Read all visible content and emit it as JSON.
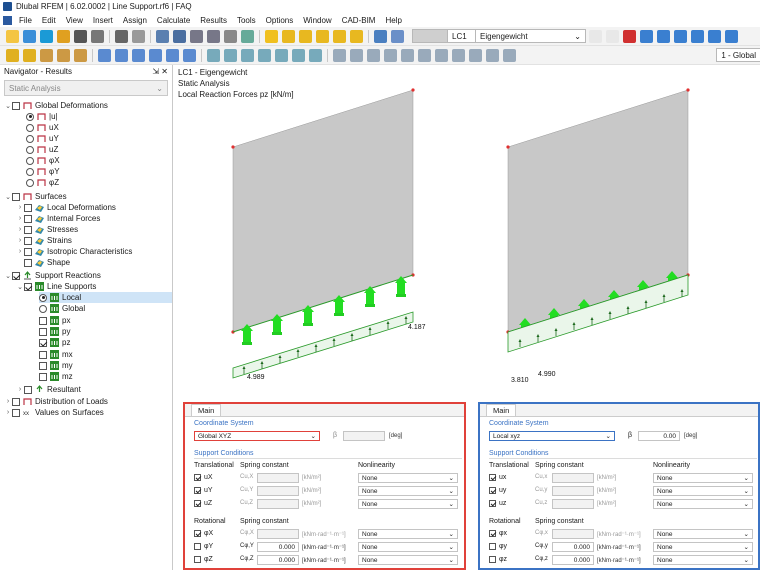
{
  "app": {
    "title": "Dlubal RFEM | 6.02.0002 | Line Support.rf6 | FAQ"
  },
  "menu": [
    "File",
    "Edit",
    "View",
    "Insert",
    "Assign",
    "Calculate",
    "Results",
    "Tools",
    "Options",
    "Window",
    "CAD-BIM",
    "Help"
  ],
  "toolbar": {
    "lc_id": "LC1",
    "lc_name": "Eigengewicht",
    "view_label": "1 - Global"
  },
  "navigator": {
    "title": "Navigator - Results",
    "combo": "Static Analysis",
    "items": {
      "global_deformations": "Global Deformations",
      "u": "|u|",
      "ux": "uX",
      "uy": "uY",
      "uz": "uZ",
      "phix": "φX",
      "phiy": "φY",
      "phiz": "φZ",
      "surfaces": "Surfaces",
      "local_deformations": "Local Deformations",
      "internal_forces": "Internal Forces",
      "stresses": "Stresses",
      "strains": "Strains",
      "isotropic": "Isotropic Characteristics",
      "shape": "Shape",
      "support_reactions": "Support Reactions",
      "line_supports": "Line Supports",
      "local": "Local",
      "global": "Global",
      "px": "px",
      "py": "py",
      "pz": "pz",
      "mx": "mx",
      "my": "my",
      "mz": "mz",
      "resultant": "Resultant",
      "distribution": "Distribution of Loads",
      "values_on_surfaces": "Values on Surfaces"
    }
  },
  "viewport": {
    "line1": "LC1 - Eigengewicht",
    "line2": "Static Analysis",
    "line3": "Local Reaction Forces pz [kN/m]",
    "labels": {
      "left_a": "4.989",
      "left_b": "4.187",
      "right_a": "3.810",
      "right_b": "4.990"
    }
  },
  "dialog_left": {
    "tab": "Main",
    "coord_section": "Coordinate System",
    "coord_value": "Global XYZ",
    "beta_label": "β",
    "beta_value": "",
    "beta_unit": "[deg]",
    "support_section": "Support Conditions",
    "translational": "Translational",
    "spring_constant": "Spring constant",
    "nonlinearity": "Nonlinearity",
    "rows_t": [
      {
        "label": "uX",
        "c": "Cu,X",
        "unit": "[kN/m²]",
        "nl": "None"
      },
      {
        "label": "uY",
        "c": "Cu,Y",
        "unit": "[kN/m²]",
        "nl": "None"
      },
      {
        "label": "uZ",
        "c": "Cu,Z",
        "unit": "[kN/m²]",
        "nl": "None"
      }
    ],
    "rotational": "Rotational",
    "rows_r": [
      {
        "label": "φX",
        "c": "Cφ,X",
        "val": "",
        "unit": "[kNm·rad⁻¹·m⁻¹]",
        "nl": "None"
      },
      {
        "label": "φY",
        "c": "Cφ,Y",
        "val": "0.000",
        "unit": "[kNm·rad⁻¹·m⁻¹]",
        "nl": "None"
      },
      {
        "label": "φZ",
        "c": "Cφ,Z",
        "val": "0.000",
        "unit": "[kNm·rad⁻¹·m⁻¹]",
        "nl": "None"
      }
    ]
  },
  "dialog_right": {
    "tab": "Main",
    "coord_section": "Coordinate System",
    "coord_value": "Local xyz",
    "beta_label": "β",
    "beta_value": "0.00",
    "beta_unit": "[deg]",
    "support_section": "Support Conditions",
    "translational": "Translational",
    "spring_constant": "Spring constant",
    "nonlinearity": "Nonlinearity",
    "rows_t": [
      {
        "label": "ux",
        "c": "Cu,x",
        "unit": "[kN/m²]",
        "nl": "None"
      },
      {
        "label": "uy",
        "c": "Cu,y",
        "unit": "[kN/m²]",
        "nl": "None"
      },
      {
        "label": "uz",
        "c": "Cu,z",
        "unit": "[kN/m²]",
        "nl": "None"
      }
    ],
    "rotational": "Rotational",
    "rows_r": [
      {
        "label": "φx",
        "c": "Cφ,x",
        "val": "",
        "unit": "[kNm·rad⁻¹·m⁻¹]",
        "nl": "None"
      },
      {
        "label": "φy",
        "c": "Cφ,y",
        "val": "0.000",
        "unit": "[kNm·rad⁻¹·m⁻¹]",
        "nl": "None"
      },
      {
        "label": "φz",
        "c": "Cφ,z",
        "val": "0.000",
        "unit": "[kNm·rad⁻¹·m⁻¹]",
        "nl": "None"
      }
    ]
  }
}
